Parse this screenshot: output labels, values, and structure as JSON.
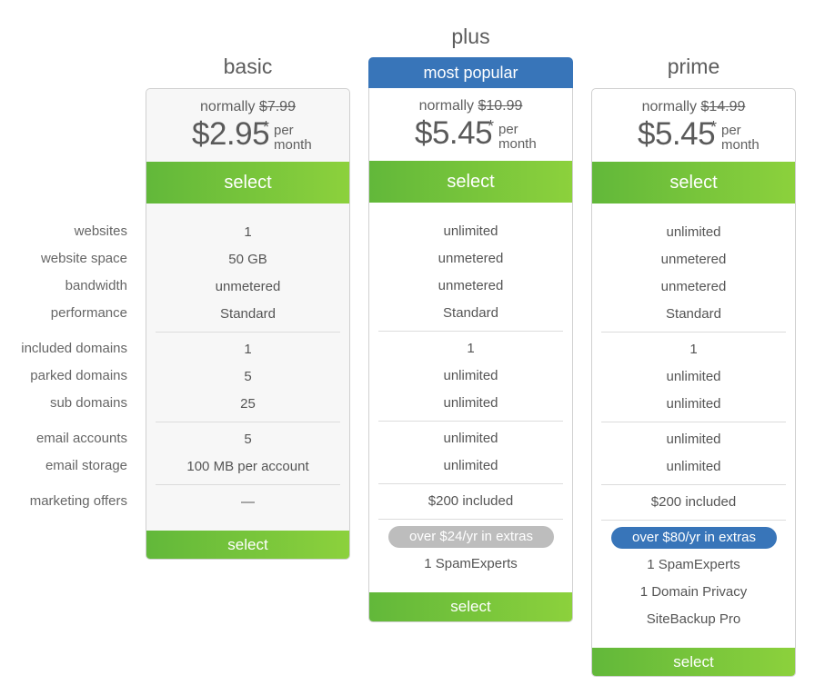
{
  "feature_labels": [
    "websites",
    "website space",
    "bandwidth",
    "performance",
    "included domains",
    "parked domains",
    "sub domains",
    "email accounts",
    "email storage",
    "marketing offers"
  ],
  "colors": {
    "select_gradient_start": "#62b83a",
    "select_gradient_end": "#8cd13c",
    "popular_blue": "#3875b9",
    "extras_grey": "#bdbdbd"
  },
  "plans": [
    {
      "name": "basic",
      "normally_label": "normally",
      "old_price": "$7.99",
      "price": "$2.95",
      "asterisk": "*",
      "per": "per",
      "month": "month",
      "select_label": "select",
      "features": [
        "1",
        "50 GB",
        "unmetered",
        "Standard",
        "1",
        "5",
        "25",
        "5",
        "100 MB per account",
        "—"
      ],
      "bottom_select_label": "select"
    },
    {
      "name": "plus",
      "badge": "most popular",
      "normally_label": "normally",
      "old_price": "$10.99",
      "price": "$5.45",
      "asterisk": "*",
      "per": "per",
      "month": "month",
      "select_label": "select",
      "features": [
        "unlimited",
        "unmetered",
        "unmetered",
        "Standard",
        "1",
        "unlimited",
        "unlimited",
        "unlimited",
        "unlimited",
        "$200 included"
      ],
      "extras_pill": "over $24/yr in extras",
      "extras": [
        "1 SpamExperts"
      ],
      "bottom_select_label": "select"
    },
    {
      "name": "prime",
      "normally_label": "normally",
      "old_price": "$14.99",
      "price": "$5.45",
      "asterisk": "*",
      "per": "per",
      "month": "month",
      "select_label": "select",
      "features": [
        "unlimited",
        "unmetered",
        "unmetered",
        "Standard",
        "1",
        "unlimited",
        "unlimited",
        "unlimited",
        "unlimited",
        "$200 included"
      ],
      "extras_pill": "over $80/yr in extras",
      "extras": [
        "1 SpamExperts",
        "1 Domain Privacy",
        "SiteBackup Pro"
      ],
      "bottom_select_label": "select"
    }
  ]
}
